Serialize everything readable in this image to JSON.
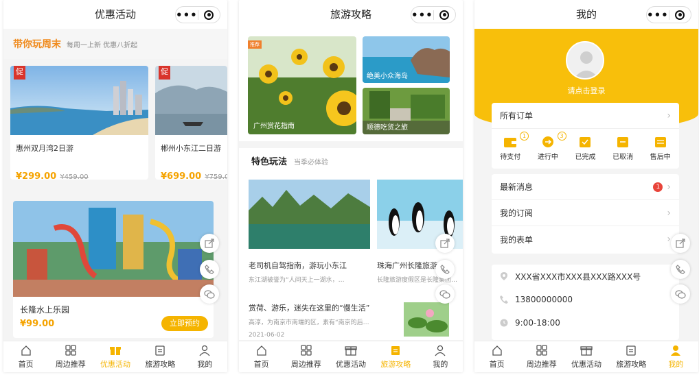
{
  "screens": {
    "promo": {
      "title": "优惠活动",
      "section_title": "带你玩周末",
      "section_sub": "每周一上新 优惠八折起",
      "badge": "促",
      "products": [
        {
          "name": "惠州双月湾2日游",
          "price": "¥299.00",
          "old_price": "¥459.00"
        },
        {
          "name": "郴州小东江二日游",
          "price": "¥699.00",
          "old_price": "¥759.0"
        }
      ],
      "feature": {
        "name": "长隆水上乐园",
        "price": "¥99.00",
        "button": "立即预约"
      }
    },
    "guide": {
      "title": "旅游攻略",
      "hot_tag": "推荐",
      "banners": [
        "广州赏花指南",
        "绝美小众海岛",
        "顺德吃货之旅"
      ],
      "section_title": "特色玩法",
      "section_sub": "当季必体验",
      "cards": [
        {
          "title": "老司机自驾指南，游玩小东江",
          "desc": "东江湖被誉为“人间天上一湖水，…"
        },
        {
          "title": "珠海广州长隆旅游",
          "desc": "长隆旅游度假区是长隆集团…"
        }
      ],
      "article": {
        "title": "赏荷、游乐，迷失在这里的“慢生活”",
        "desc": "高淳，为南京市南端的区，素有“南京的后…",
        "date": "2021-06-02"
      }
    },
    "mine": {
      "title": "我的",
      "login": "请点击登录",
      "orders_label": "所有订单",
      "order_icons": [
        {
          "label": "待支付",
          "count": "1"
        },
        {
          "label": "进行中",
          "count": "3"
        },
        {
          "label": "已完成",
          "count": ""
        },
        {
          "label": "已取消",
          "count": ""
        },
        {
          "label": "售后中",
          "count": ""
        }
      ],
      "menu": [
        {
          "label": "最新消息",
          "badge": "1"
        },
        {
          "label": "我的订阅",
          "badge": ""
        },
        {
          "label": "我的表单",
          "badge": ""
        }
      ],
      "contact": {
        "address": "XXX省XXX市XXX县XXX路XXX号",
        "phone": "13800000000",
        "hours": "9:00-18:00"
      }
    }
  },
  "tabbar": [
    "首页",
    "周边推荐",
    "优惠活动",
    "旅游攻略",
    "我的"
  ],
  "colors": {
    "accent": "#f5b400",
    "price": "#f5a300",
    "promo_title": "#f08a1c"
  }
}
